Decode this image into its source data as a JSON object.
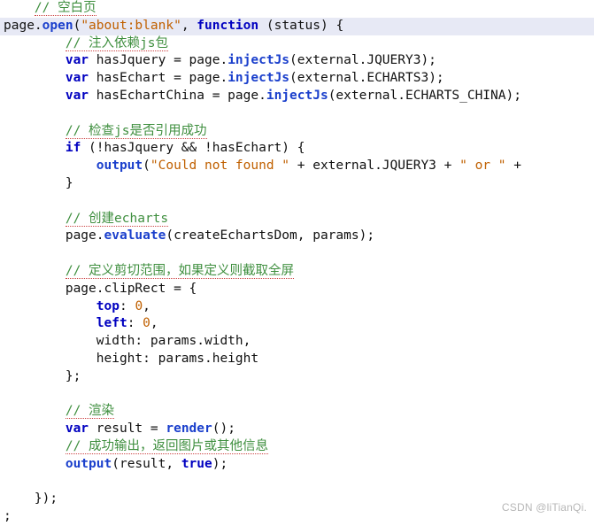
{
  "editor": {
    "language": "javascript",
    "highlighted_line_index": 1,
    "colors": {
      "comment": "#3f8f3f",
      "keyword": "#0000c0",
      "function": "#1a3fcc",
      "string": "#c06000",
      "number": "#c06000",
      "plain": "#111111",
      "highlight_background": "#e7e9f5",
      "background": "#ffffff"
    },
    "lines": [
      {
        "indent": 1,
        "tokens": [
          {
            "t": "// 空白页",
            "c": "cmt"
          }
        ]
      },
      {
        "indent": 0,
        "tokens": [
          {
            "t": "page",
            "c": "pl"
          },
          {
            "t": ".",
            "c": "pun"
          },
          {
            "t": "open",
            "c": "fn"
          },
          {
            "t": "(",
            "c": "pun"
          },
          {
            "t": "\"about:blank\"",
            "c": "str"
          },
          {
            "t": ", ",
            "c": "pun"
          },
          {
            "t": "function",
            "c": "kw"
          },
          {
            "t": " (",
            "c": "pun"
          },
          {
            "t": "status",
            "c": "pl"
          },
          {
            "t": ") {",
            "c": "pun"
          }
        ]
      },
      {
        "indent": 2,
        "tokens": [
          {
            "t": "// 注入依赖js包",
            "c": "cmt"
          }
        ]
      },
      {
        "indent": 2,
        "tokens": [
          {
            "t": "var",
            "c": "kw"
          },
          {
            "t": " hasJquery = page",
            "c": "pl"
          },
          {
            "t": ".",
            "c": "pun"
          },
          {
            "t": "injectJs",
            "c": "fn"
          },
          {
            "t": "(external",
            "c": "pl"
          },
          {
            "t": ".",
            "c": "pun"
          },
          {
            "t": "JQUERY3",
            "c": "pl"
          },
          {
            "t": ");",
            "c": "pun"
          }
        ]
      },
      {
        "indent": 2,
        "tokens": [
          {
            "t": "var",
            "c": "kw"
          },
          {
            "t": " hasEchart = page",
            "c": "pl"
          },
          {
            "t": ".",
            "c": "pun"
          },
          {
            "t": "injectJs",
            "c": "fn"
          },
          {
            "t": "(external",
            "c": "pl"
          },
          {
            "t": ".",
            "c": "pun"
          },
          {
            "t": "ECHARTS3",
            "c": "pl"
          },
          {
            "t": ");",
            "c": "pun"
          }
        ]
      },
      {
        "indent": 2,
        "tokens": [
          {
            "t": "var",
            "c": "kw"
          },
          {
            "t": " hasEchartChina = page",
            "c": "pl"
          },
          {
            "t": ".",
            "c": "pun"
          },
          {
            "t": "injectJs",
            "c": "fn"
          },
          {
            "t": "(external",
            "c": "pl"
          },
          {
            "t": ".",
            "c": "pun"
          },
          {
            "t": "ECHARTS_CHINA",
            "c": "pl"
          },
          {
            "t": ");",
            "c": "pun"
          }
        ]
      },
      {
        "indent": 0,
        "tokens": []
      },
      {
        "indent": 2,
        "tokens": [
          {
            "t": "// 检查js是否引用成功",
            "c": "cmt"
          }
        ]
      },
      {
        "indent": 2,
        "tokens": [
          {
            "t": "if",
            "c": "kw"
          },
          {
            "t": " (!hasJquery && !hasEchart) {",
            "c": "pl"
          }
        ]
      },
      {
        "indent": 3,
        "tokens": [
          {
            "t": "output",
            "c": "fn"
          },
          {
            "t": "(",
            "c": "pun"
          },
          {
            "t": "\"Could not found \"",
            "c": "str"
          },
          {
            "t": " + external",
            "c": "pl"
          },
          {
            "t": ".",
            "c": "pun"
          },
          {
            "t": "JQUERY3 + ",
            "c": "pl"
          },
          {
            "t": "\" or \"",
            "c": "str"
          },
          {
            "t": " +",
            "c": "pl"
          }
        ]
      },
      {
        "indent": 2,
        "tokens": [
          {
            "t": "}",
            "c": "pun"
          }
        ]
      },
      {
        "indent": 0,
        "tokens": []
      },
      {
        "indent": 2,
        "tokens": [
          {
            "t": "// 创建echarts",
            "c": "cmt"
          }
        ]
      },
      {
        "indent": 2,
        "tokens": [
          {
            "t": "page",
            "c": "pl"
          },
          {
            "t": ".",
            "c": "pun"
          },
          {
            "t": "evaluate",
            "c": "fn"
          },
          {
            "t": "(createEchartsDom, params);",
            "c": "pl"
          }
        ]
      },
      {
        "indent": 0,
        "tokens": []
      },
      {
        "indent": 2,
        "tokens": [
          {
            "t": "// 定义剪切范围，如果定义则截取全屏",
            "c": "cmt"
          }
        ]
      },
      {
        "indent": 2,
        "tokens": [
          {
            "t": "page",
            "c": "pl"
          },
          {
            "t": ".",
            "c": "pun"
          },
          {
            "t": "clipRect",
            "c": "pl"
          },
          {
            "t": " = {",
            "c": "pun"
          }
        ]
      },
      {
        "indent": 3,
        "tokens": [
          {
            "t": "top",
            "c": "kw"
          },
          {
            "t": ": ",
            "c": "pun"
          },
          {
            "t": "0",
            "c": "num"
          },
          {
            "t": ",",
            "c": "pun"
          }
        ]
      },
      {
        "indent": 3,
        "tokens": [
          {
            "t": "left",
            "c": "kw"
          },
          {
            "t": ": ",
            "c": "pun"
          },
          {
            "t": "0",
            "c": "num"
          },
          {
            "t": ",",
            "c": "pun"
          }
        ]
      },
      {
        "indent": 3,
        "tokens": [
          {
            "t": "width: params.width,",
            "c": "pl"
          }
        ]
      },
      {
        "indent": 3,
        "tokens": [
          {
            "t": "height: params.height",
            "c": "pl"
          }
        ]
      },
      {
        "indent": 2,
        "tokens": [
          {
            "t": "};",
            "c": "pun"
          }
        ]
      },
      {
        "indent": 0,
        "tokens": []
      },
      {
        "indent": 2,
        "tokens": [
          {
            "t": "// 渲染",
            "c": "cmt"
          }
        ]
      },
      {
        "indent": 2,
        "tokens": [
          {
            "t": "var",
            "c": "kw"
          },
          {
            "t": " result = ",
            "c": "pl"
          },
          {
            "t": "render",
            "c": "fn"
          },
          {
            "t": "();",
            "c": "pun"
          }
        ]
      },
      {
        "indent": 2,
        "tokens": [
          {
            "t": "// 成功输出，返回图片或其他信息",
            "c": "cmt"
          }
        ]
      },
      {
        "indent": 2,
        "tokens": [
          {
            "t": "output",
            "c": "fn"
          },
          {
            "t": "(result, ",
            "c": "pun"
          },
          {
            "t": "true",
            "c": "kw"
          },
          {
            "t": ");",
            "c": "pun"
          }
        ]
      },
      {
        "indent": 0,
        "tokens": []
      },
      {
        "indent": 1,
        "tokens": [
          {
            "t": "});",
            "c": "pun"
          }
        ]
      },
      {
        "indent": 0,
        "tokens": [
          {
            "t": ";",
            "c": "pun"
          }
        ]
      }
    ]
  },
  "watermark": {
    "text": "CSDN @liTianQi."
  }
}
